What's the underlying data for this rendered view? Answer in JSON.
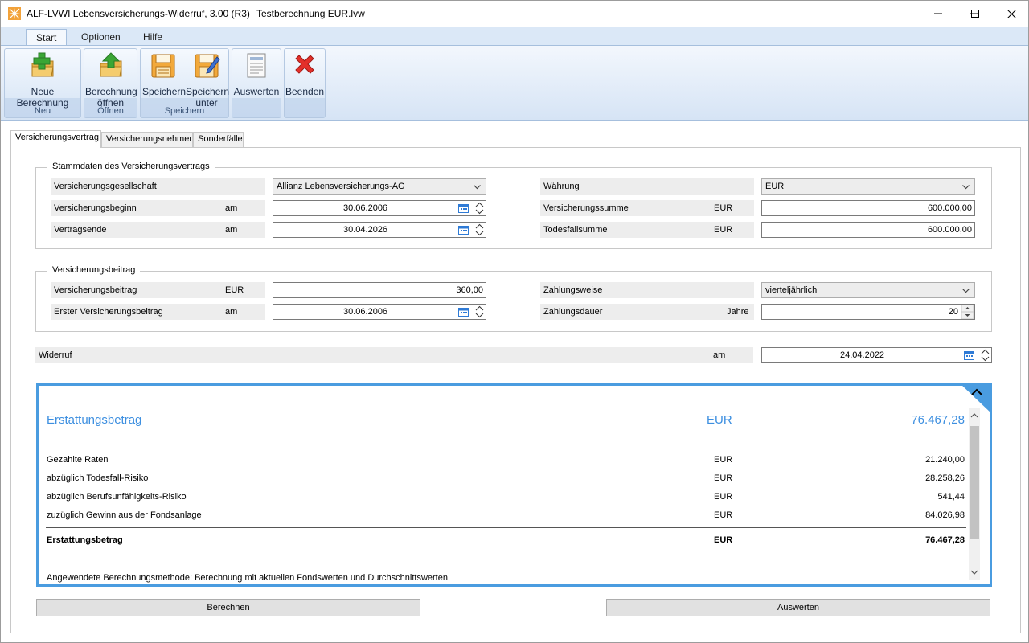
{
  "window": {
    "app_title": "ALF-LVWI Lebensversicherungs-Widerruf, 3.00 (R3)",
    "document_title": "Testberechnung EUR.lvw"
  },
  "ribbon": {
    "tabs": [
      "Start",
      "Optionen",
      "Hilfe"
    ],
    "active_tab": "Start",
    "groups": {
      "neu": {
        "label": "Neu",
        "buttons": [
          {
            "label1": "Neue Berechnung",
            "label2": "",
            "icon": "new-calculation-icon"
          }
        ]
      },
      "oeffnen": {
        "label": "Öffnen",
        "buttons": [
          {
            "label1": "Berechnung",
            "label2": "öffnen",
            "icon": "open-calculation-icon"
          }
        ]
      },
      "speichern": {
        "label": "Speichern",
        "buttons": [
          {
            "label1": "Speichern",
            "label2": "",
            "icon": "save-icon"
          },
          {
            "label1": "Speichern",
            "label2": "unter",
            "icon": "save-as-icon"
          }
        ]
      },
      "auswerten": {
        "label": "",
        "buttons": [
          {
            "label1": "Auswerten",
            "label2": "",
            "icon": "report-icon"
          }
        ]
      },
      "beenden": {
        "label": "",
        "buttons": [
          {
            "label1": "Beenden",
            "label2": "",
            "icon": "close-x-icon"
          }
        ]
      }
    }
  },
  "tabs": [
    "Versicherungsvertrag",
    "Versicherungsnehmer",
    "Sonderfälle"
  ],
  "contract": {
    "title": "Stammdaten des Versicherungsvertrags",
    "company_label": "Versicherungsgesellschaft",
    "company_value": "Allianz Lebensversicherungs-AG",
    "begin_label": "Versicherungsbeginn",
    "begin_unit": "am",
    "begin_value": "30.06.2006",
    "end_label": "Vertragsende",
    "end_unit": "am",
    "end_value": "30.04.2026",
    "currency_label": "Währung",
    "currency_value": "EUR",
    "sum_label": "Versicherungssumme",
    "sum_unit": "EUR",
    "sum_value": "600.000,00",
    "death_label": "Todesfallsumme",
    "death_unit": "EUR",
    "death_value": "600.000,00"
  },
  "premium": {
    "title": "Versicherungsbeitrag",
    "amount_label": "Versicherungsbeitrag",
    "amount_unit": "EUR",
    "amount_value": "360,00",
    "first_label": "Erster Versicherungsbeitrag",
    "first_unit": "am",
    "first_value": "30.06.2006",
    "mode_label": "Zahlungsweise",
    "mode_value": "vierteljährlich",
    "duration_label": "Zahlungsdauer",
    "duration_unit": "Jahre",
    "duration_value": "20"
  },
  "revocation": {
    "label": "Widerruf",
    "unit": "am",
    "value": "24.04.2022"
  },
  "result": {
    "headline_label": "Erstattungsbetrag",
    "headline_currency": "EUR",
    "headline_value": "76.467,28",
    "rows": [
      {
        "label": "Gezahlte Raten",
        "currency": "EUR",
        "value": "21.240,00"
      },
      {
        "label": "abzüglich Todesfall-Risiko",
        "currency": "EUR",
        "value": "28.258,26"
      },
      {
        "label": "abzüglich Berufsunfähigkeits-Risiko",
        "currency": "EUR",
        "value": "541,44"
      },
      {
        "label": "zuzüglich Gewinn aus der Fondsanlage",
        "currency": "EUR",
        "value": "84.026,98"
      }
    ],
    "total_label": "Erstattungsbetrag",
    "total_currency": "EUR",
    "total_value": "76.467,28",
    "method_text": "Angewendete Berechnungsmethode: Berechnung mit aktuellen Fondswerten und Durchschnittswerten"
  },
  "actions": {
    "calculate_label": "Berechnen",
    "evaluate_label": "Auswerten"
  }
}
